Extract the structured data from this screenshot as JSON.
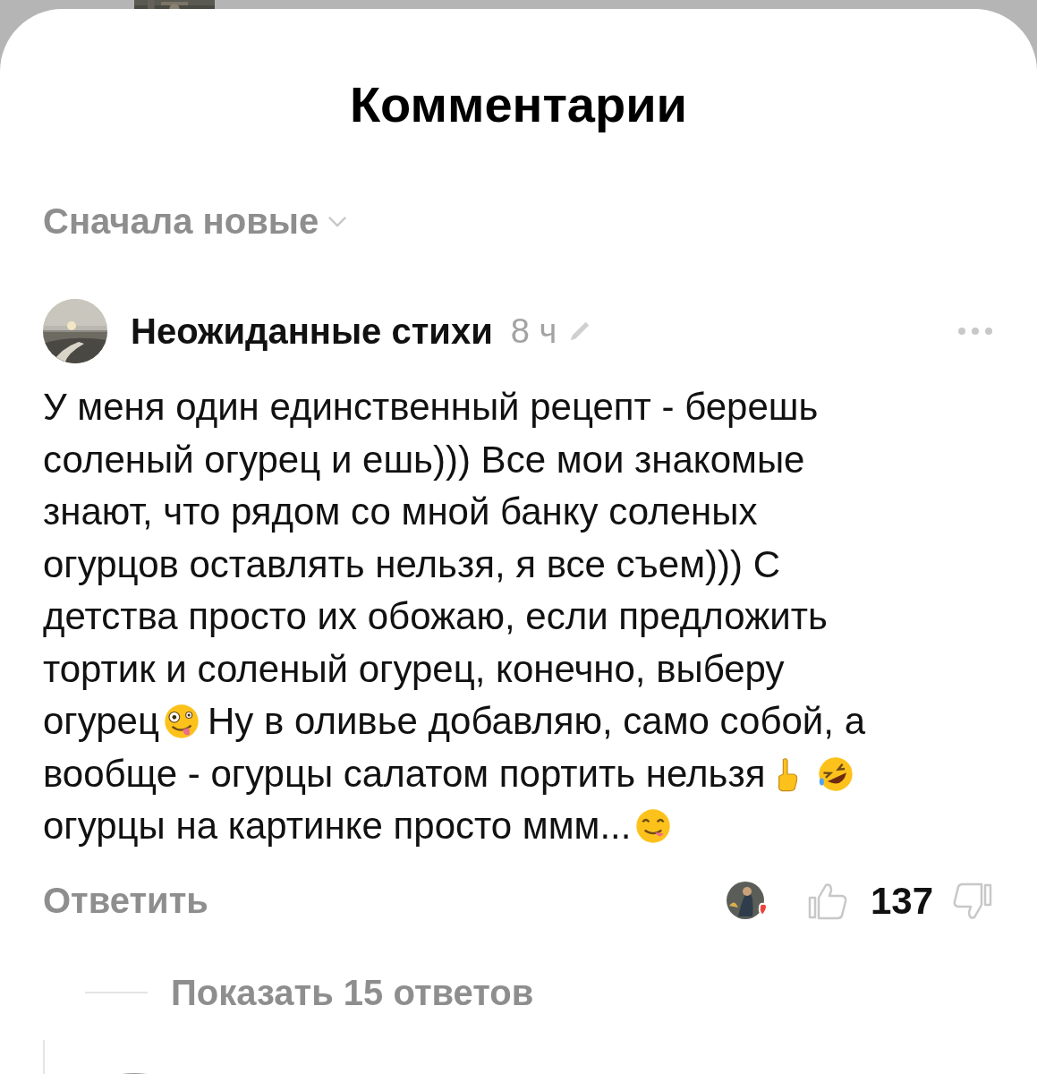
{
  "sheet": {
    "title": "Комментарии",
    "sort": {
      "label": "Сначала новые"
    }
  },
  "comment": {
    "author": "Неожиданные стихи",
    "time": "8 ч",
    "edited": true,
    "body_lines": [
      [
        {
          "kind": "text",
          "text": "У меня один единственный рецепт - берешь"
        }
      ],
      [
        {
          "kind": "text",
          "text": "соленый огурец и ешь))) Все мои знакомые"
        }
      ],
      [
        {
          "kind": "text",
          "text": "знают, что рядом со мной банку соленых"
        }
      ],
      [
        {
          "kind": "text",
          "text": "огурцов оставлять нельзя, я все съем))) С"
        }
      ],
      [
        {
          "kind": "text",
          "text": "детства просто их обожаю, если предложить"
        }
      ],
      [
        {
          "kind": "text",
          "text": "тортик и соленый огурец, конечно, выберу"
        }
      ],
      [
        {
          "kind": "text",
          "text": "огурец"
        },
        {
          "kind": "zany"
        },
        {
          "kind": "text",
          "text": "Ну в оливье добавляю, само собой, а"
        }
      ],
      [
        {
          "kind": "text",
          "text": "вообще - огурцы салатом портить нельзя"
        },
        {
          "kind": "finger"
        },
        {
          "kind": "rofl"
        }
      ],
      [
        {
          "kind": "text",
          "text": "огурцы на картинке просто ммм..."
        },
        {
          "kind": "yum"
        }
      ]
    ],
    "reply_label": "Ответить",
    "author_liked": true,
    "likes": "137",
    "liked": false,
    "disliked": false,
    "show_replies": "Показать 15 ответов"
  }
}
